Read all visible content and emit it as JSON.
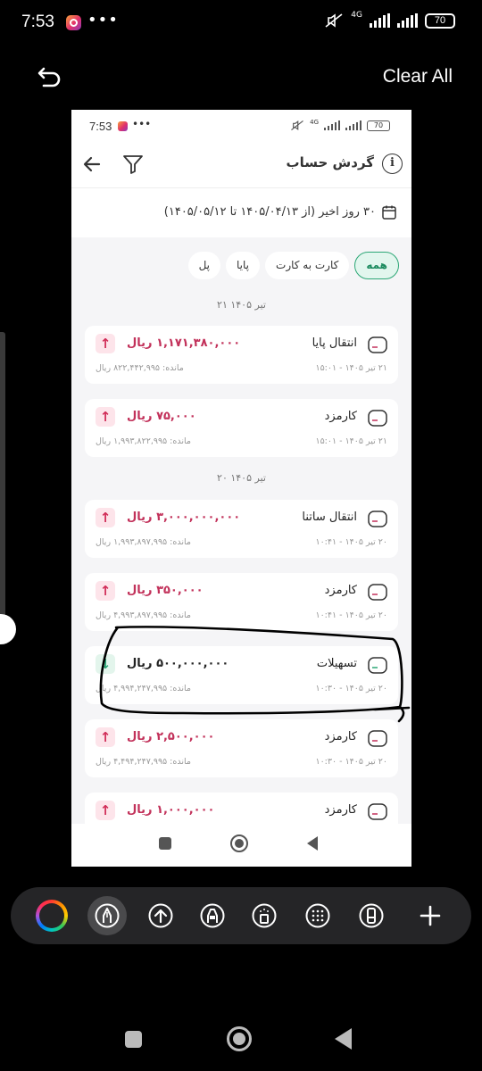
{
  "outer_status": {
    "time": "7:53",
    "dots": "•••",
    "network": "4G",
    "battery": "70"
  },
  "top_bar": {
    "clear_all": "Clear All"
  },
  "inner_status": {
    "time": "7:53",
    "dots": "•••",
    "network": "4G",
    "battery": "70"
  },
  "header": {
    "title": "گردش حساب",
    "info": "i"
  },
  "date_range": {
    "text": "۳۰ روز اخیر (از  ۱۴۰۵/۰۴/۱۳  تا  ۱۴۰۵/۰۵/۱۲)"
  },
  "filters": [
    {
      "label": "همه",
      "active": true
    },
    {
      "label": "کارت به کارت",
      "active": false
    },
    {
      "label": "پایا",
      "active": false
    },
    {
      "label": "پل",
      "active": false
    }
  ],
  "groups": [
    {
      "day": "۲۱ تیر ۱۴۰۵",
      "items": [
        {
          "title": "انتقال پایا",
          "amount": "۱,۱۷۱,۳۸۰,۰۰۰ ریال",
          "direction": "out",
          "datetime": "۲۱ تیر ۱۴۰۵ - ۱۵:۰۱",
          "balance": "مانده: ۸۲۲,۴۴۲,۹۹۵ ریال"
        },
        {
          "title": "کارمزد",
          "amount": "۷۵,۰۰۰ ریال",
          "direction": "out",
          "datetime": "۲۱ تیر ۱۴۰۵ - ۱۵:۰۱",
          "balance": "مانده: ۱,۹۹۳,۸۲۲,۹۹۵ ریال"
        }
      ]
    },
    {
      "day": "۲۰ تیر ۱۴۰۵",
      "items": [
        {
          "title": "انتقال ساتنا",
          "amount": "۳,۰۰۰,۰۰۰,۰۰۰ ریال",
          "direction": "out",
          "datetime": "۲۰ تیر ۱۴۰۵ - ۱۰:۴۱",
          "balance": "مانده: ۱,۹۹۳,۸۹۷,۹۹۵ ریال"
        },
        {
          "title": "کارمزد",
          "amount": "۳۵۰,۰۰۰ ریال",
          "direction": "out",
          "datetime": "۲۰ تیر ۱۴۰۵ - ۱۰:۴۱",
          "balance": "مانده: ۴,۹۹۳,۸۹۷,۹۹۵ ریال"
        },
        {
          "title": "تسهیلات",
          "amount": "۵۰۰,۰۰۰,۰۰۰ ریال",
          "direction": "in",
          "datetime": "۲۰ تیر ۱۴۰۵ - ۱۰:۳۰",
          "balance": "مانده: ۴,۹۹۴,۲۴۷,۹۹۵ ریال"
        },
        {
          "title": "کارمزد",
          "amount": "۲,۵۰۰,۰۰۰ ریال",
          "direction": "out",
          "datetime": "۲۰ تیر ۱۴۰۵ - ۱۰:۳۰",
          "balance": "مانده: ۴,۴۹۴,۲۴۷,۹۹۵ ریال"
        },
        {
          "title": "کارمزد",
          "amount": "۱,۰۰۰,۰۰۰ ریال",
          "direction": "out",
          "datetime": "",
          "balance": ""
        }
      ]
    }
  ],
  "colors": {
    "accent_green": "#2ca776",
    "out_red": "#c2315a"
  }
}
